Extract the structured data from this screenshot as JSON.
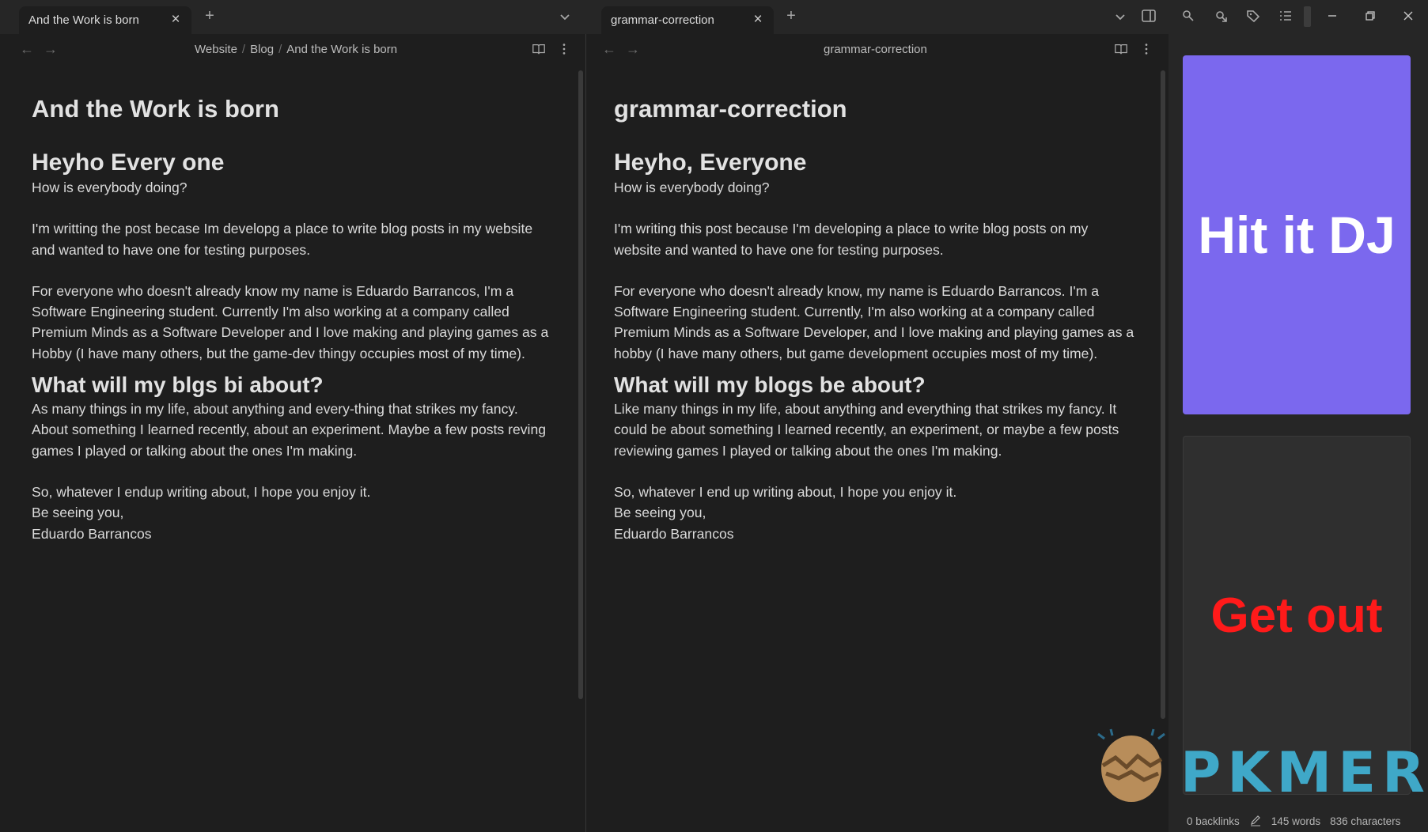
{
  "tabs": [
    {
      "label": "And the Work is born"
    },
    {
      "label": "grammar-correction"
    }
  ],
  "left_pane": {
    "breadcrumb": [
      "Website",
      "Blog",
      "And the Work is born"
    ],
    "title": "And the Work is born",
    "heading1": "Heyho Every one",
    "p1": "How is everybody doing?",
    "p2": "I'm writting the post becase Im developg a place to write blog posts in my website and wanted to have one for testing purposes.",
    "p3": "For everyone who doesn't already know my name is Eduardo Barrancos, I'm a Software Engineering student. Currently I'm also working at a company called Premium Minds as a Software Developer and I love making and playing games as a Hobby (I have many others, but the game-dev thingy occupies most of my time).",
    "heading2": "What will my blgs bi about?",
    "p4": "As many things in my life, about anything and every-thing that strikes my fancy. About something I learned recently, about an experiment. Maybe a few posts reving games I played or talking about the ones I'm making.",
    "p5a": "So, whatever I endup writing about, I hope you enjoy it.",
    "p5b": "Be seeing you,",
    "p5c": "Eduardo Barrancos"
  },
  "right_pane": {
    "header_title": "grammar-correction",
    "title": "grammar-correction",
    "heading1": "Heyho, Everyone",
    "p1": "How is everybody doing?",
    "p2": "I'm writing this post because I'm developing a place to write blog posts on my website and wanted to have one for testing purposes.",
    "p3": "For everyone who doesn't already know, my name is Eduardo Barrancos. I'm a Software Engineering student. Currently, I'm also working at a company called Premium Minds as a Software Developer, and I love making and playing games as a hobby (I have many others, but game development occupies most of my time).",
    "heading2": "What will my blogs be about?",
    "p4": "Like many things in my life, about anything and everything that strikes my fancy. It could be about something I learned recently, an experiment, or maybe a few posts reviewing games I played or talking about the ones I'm making.",
    "p5a": "So, whatever I end up writing about, I hope you enjoy it.",
    "p5b": "Be seeing you,",
    "p5c": "Eduardo Barrancos"
  },
  "sidebar": {
    "card1_text": "Hit it DJ",
    "card2_text": "Get out"
  },
  "status": {
    "backlinks": "0 backlinks",
    "words": "145 words",
    "characters": "836 characters"
  },
  "watermark": {
    "text": "PKMER"
  },
  "colors": {
    "accent_card": "#7b68ee",
    "warning_text": "#ff1a1a"
  }
}
